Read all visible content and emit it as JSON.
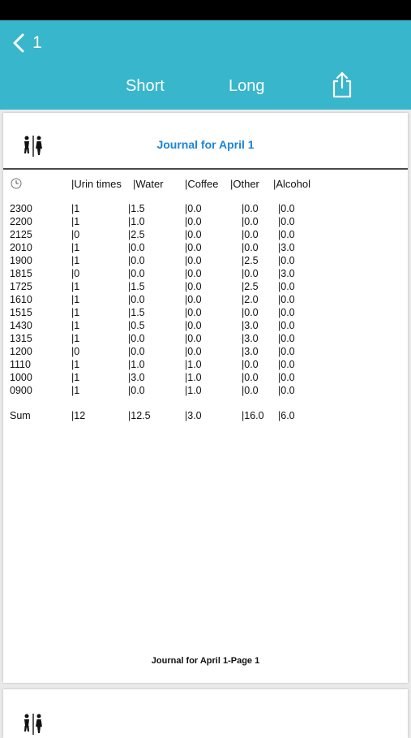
{
  "nav": {
    "back_label": "1",
    "short_label": "Short",
    "long_label": "Long"
  },
  "page1": {
    "title": "Journal for April 1",
    "columns": [
      "|Urin times",
      "|Water",
      "|Coffee",
      "|Other",
      "|Alcohol"
    ],
    "rows": [
      [
        "2300",
        "|1",
        "|1.5",
        "|0.0",
        "|0.0",
        "|0.0"
      ],
      [
        "2200",
        "|1",
        "|1.0",
        "|0.0",
        "|0.0",
        "|0.0"
      ],
      [
        "2125",
        "|0",
        "|2.5",
        "|0.0",
        "|0.0",
        "|0.0"
      ],
      [
        "2010",
        "|1",
        "|0.0",
        "|0.0",
        "|0.0",
        "|3.0"
      ],
      [
        "1900",
        "|1",
        "|0.0",
        "|0.0",
        "|2.5",
        "|0.0"
      ],
      [
        "1815",
        "|0",
        "|0.0",
        "|0.0",
        "|0.0",
        "|3.0"
      ],
      [
        "1725",
        "|1",
        "|1.5",
        "|0.0",
        "|2.5",
        "|0.0"
      ],
      [
        "1610",
        "|1",
        "|0.0",
        "|0.0",
        "|2.0",
        "|0.0"
      ],
      [
        "1515",
        "|1",
        "|1.5",
        "|0.0",
        "|0.0",
        "|0.0"
      ],
      [
        "1430",
        "|1",
        "|0.5",
        "|0.0",
        "|3.0",
        "|0.0"
      ],
      [
        "1315",
        "|1",
        "|0.0",
        "|0.0",
        "|3.0",
        "|0.0"
      ],
      [
        "1200",
        "|0",
        "|0.0",
        "|0.0",
        "|3.0",
        "|0.0"
      ],
      [
        "1110",
        "|1",
        "|1.0",
        "|1.0",
        "|0.0",
        "|0.0"
      ],
      [
        "1000",
        "|1",
        "|3.0",
        "|1.0",
        "|0.0",
        "|0.0"
      ],
      [
        "0900",
        "|1",
        "|0.0",
        "|1.0",
        "|0.0",
        "|0.0"
      ]
    ],
    "sum": [
      "Sum",
      "|12",
      "|12.5",
      "|3.0",
      "|16.0",
      "|6.0"
    ],
    "footer": "Journal for April 1-Page 1"
  },
  "colors": {
    "nav_bg": "#38b6cb",
    "title_blue": "#1a84d8"
  },
  "icons": {
    "back": "chevron-left-icon",
    "share": "share-icon",
    "restroom": "restroom-icon",
    "clock": "clock-icon"
  }
}
